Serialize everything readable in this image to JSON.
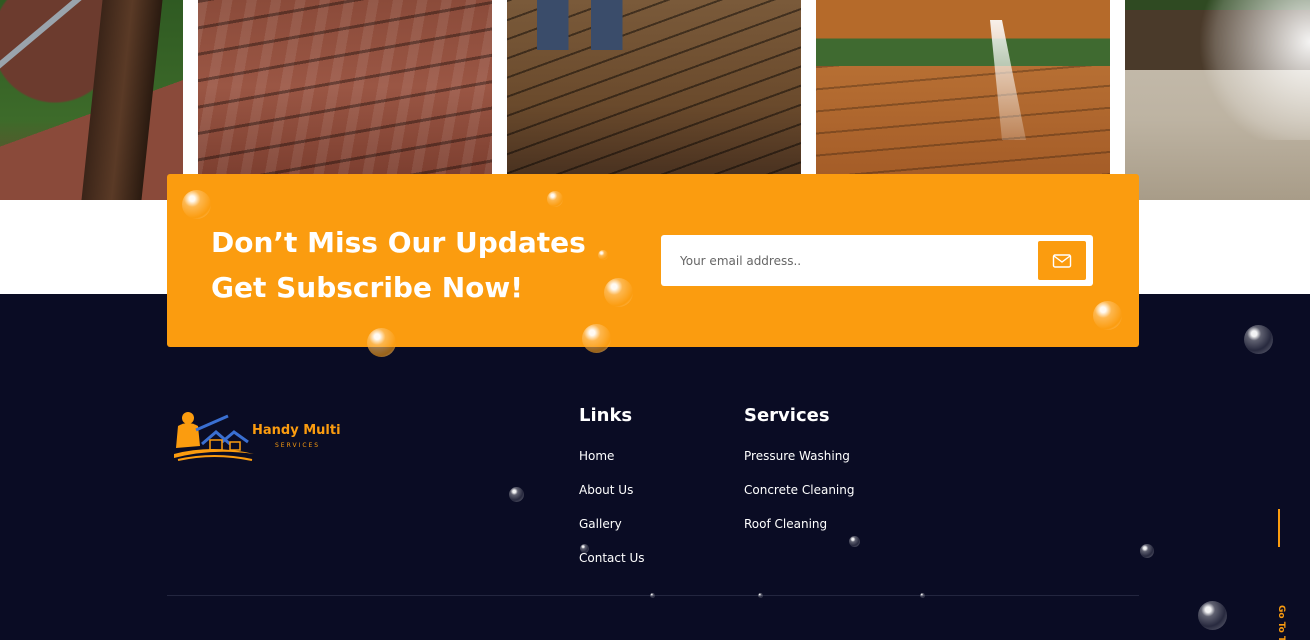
{
  "subscribe": {
    "title_line1": "Don’t Miss Our Updates",
    "title_line2": "Get Subscribe Now!",
    "email_placeholder": "Your email address..",
    "send_icon": "mail-icon"
  },
  "brand": {
    "name": "Handy Multi",
    "tagline": "SERVICES"
  },
  "links": {
    "title": "Links",
    "items": [
      "Home",
      "About Us",
      "Gallery",
      "Contact Us"
    ]
  },
  "services": {
    "title": "Services",
    "items": [
      "Pressure Washing",
      "Concrete Cleaning",
      "Roof Cleaning"
    ]
  },
  "go_top": {
    "label": "Go To Top"
  },
  "colors": {
    "accent": "#fb9c0f",
    "footer_bg": "#0a0c24",
    "text": "#ffffff"
  }
}
